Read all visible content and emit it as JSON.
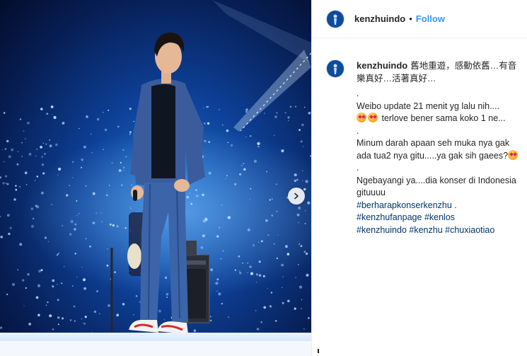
{
  "post": {
    "username": "kenzhuindo",
    "separator": "•",
    "follow_label": "Follow",
    "next_icon": "chevron-right-icon"
  },
  "caption": {
    "username": "kenzhuindo",
    "line1": "舊地重遊，感動依舊…有音樂真好…活著真好…",
    "dot1": ".",
    "line2": "Weibo update 21 menit yg lalu nih....",
    "line3": " terlove bener sama koko 1 ne...",
    "dot2": ".",
    "line4": "Minum darah apaan seh muka nya gak ada tua2 nya gitu.....ya gak sih gaees?",
    "dot3": ".",
    "line5": "Ngebayangi ya....dia konser di Indonesia gituuuu",
    "tag1": "#berharapkonserkenzhu",
    "tag1_suffix": " .",
    "tag2": "#kenzhufanpage",
    "tag3": "#kenlos",
    "tag4": "#kenzhuindo",
    "tag5": "#kenzhu",
    "tag6": "#chuxiaotiao",
    "emoji_icon": "heart-eyes-emoji-icon"
  },
  "colors": {
    "link": "#3897f0",
    "hashtag": "#003569",
    "stage_blue": "#0d3f95"
  }
}
